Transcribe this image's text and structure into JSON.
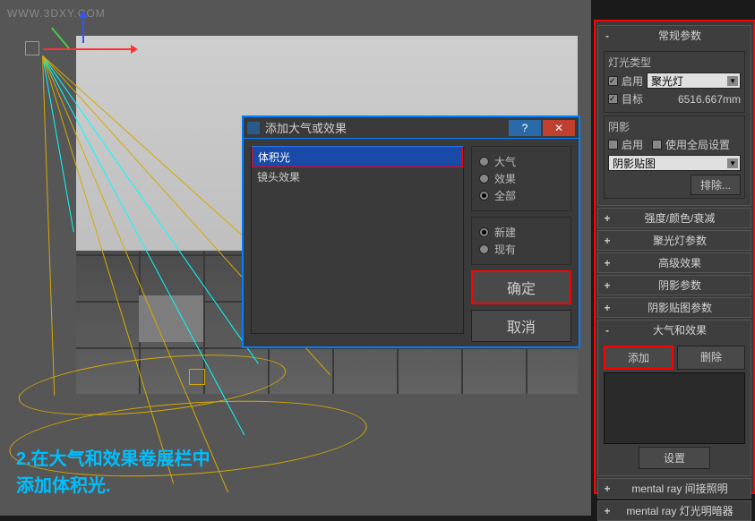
{
  "watermark": "WWW.3DXY.COM",
  "caption_line1": "2.在大气和效果卷展栏中",
  "caption_line2": "添加体积光.",
  "dialog": {
    "title": "添加大气或效果",
    "help": "?",
    "close": "✕",
    "list_item_1": "体积光",
    "list_item_2": "镜头效果",
    "radio_atmosphere": "大气",
    "radio_effect": "效果",
    "radio_all": "全部",
    "radio_new": "新建",
    "radio_existing": "现有",
    "ok": "确定",
    "cancel": "取消"
  },
  "panel": {
    "rollout_general": "常规参数",
    "light_type_group": "灯光类型",
    "enable": "启用",
    "light_type_value": "聚光灯",
    "target": "目标",
    "target_distance": "6516.667mm",
    "shadow_group": "阴影",
    "use_global": "使用全局设置",
    "shadow_type_value": "阴影贴图",
    "exclude": "排除...",
    "rollout_intensity": "强度/颜色/衰减",
    "rollout_spotlight": "聚光灯参数",
    "rollout_advanced": "高级效果",
    "rollout_shadow_params": "阴影参数",
    "rollout_shadow_map": "阴影贴图参数",
    "rollout_atmos": "大气和效果",
    "add": "添加",
    "delete": "删除",
    "setup": "设置",
    "rollout_mr_indirect": "mental ray 间接照明",
    "rollout_mr_shader": "mental ray 灯光明暗器"
  }
}
